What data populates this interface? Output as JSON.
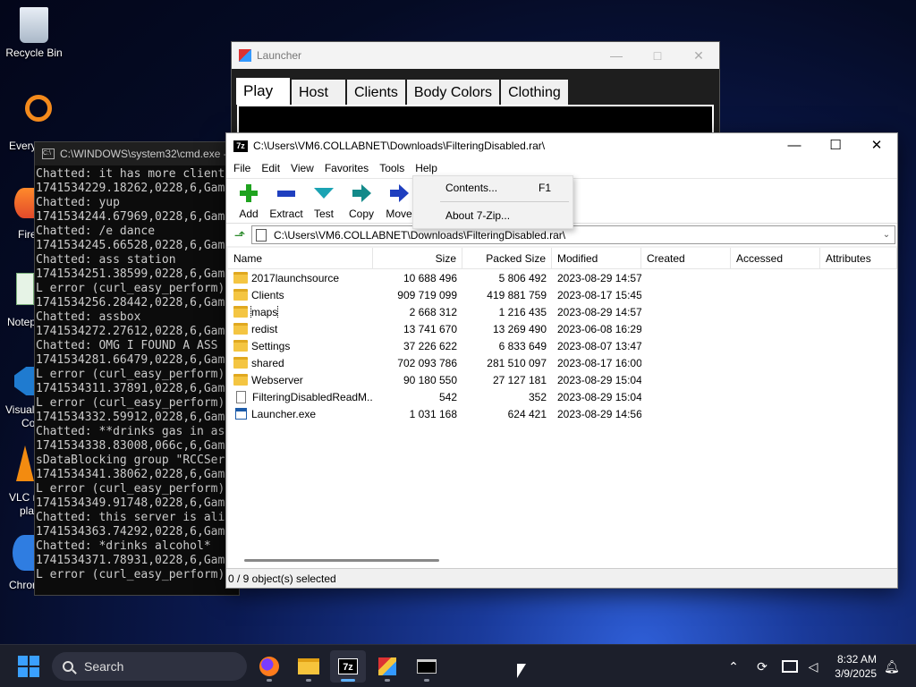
{
  "desktop": {
    "recycle_bin": "Recycle Bin",
    "partial_labels": [
      "Every",
      "Fire",
      "Notep",
      "Visual",
      "Co",
      "VLC r",
      "pla",
      "Chrom"
    ]
  },
  "launcher": {
    "title": "Launcher",
    "tabs": [
      "Play",
      "Host",
      "Clients",
      "Body Colors",
      "Clothing"
    ],
    "active_tab": "Play"
  },
  "cmd": {
    "title": "C:\\WINDOWS\\system32\\cmd.exe -",
    "lines": [
      "Chatted: it has more client",
      "1741534229.18262,0228,6,Gam",
      "Chatted: yup",
      "1741534244.67969,0228,6,Gam",
      "Chatted: /e dance",
      "1741534245.66528,0228,6,Gam",
      "Chatted: ass station",
      "1741534251.38599,0228,6,Gam",
      "L error (curl_easy_perform)",
      "1741534256.28442,0228,6,Gam",
      "Chatted: assbox",
      "1741534272.27612,0228,6,Gam",
      "Chatted: OMG I FOUND A ASS",
      "1741534281.66479,0228,6,Gam",
      "L error (curl_easy_perform)",
      "1741534311.37891,0228,6,Gam",
      "L error (curl_easy_perform)",
      "1741534332.59912,0228,6,Gam",
      "Chatted: **drinks gas in as",
      "1741534338.83008,066c,6,Gam",
      "sDataBlocking group \"RCCSer",
      "1741534341.38062,0228,6,Gam",
      "L error (curl_easy_perform)",
      "1741534349.91748,0228,6,Gam",
      "Chatted: this server is ali",
      "1741534363.74292,0228,6,Gam",
      "Chatted: *drinks alcohol*",
      "1741534371.78931,0228,6,Gam",
      "L error (curl_easy_perform)"
    ]
  },
  "zip": {
    "title": "C:\\Users\\VM6.COLLABNET\\Downloads\\FilteringDisabled.rar\\",
    "app_icon": "7z",
    "menu": [
      "File",
      "Edit",
      "View",
      "Favorites",
      "Tools",
      "Help"
    ],
    "tools": [
      {
        "label": "Add",
        "icon": "plus-icon",
        "color": "#1fa31f"
      },
      {
        "label": "Extract",
        "icon": "minus-icon",
        "color": "#1f3fbf"
      },
      {
        "label": "Test",
        "icon": "check-icon",
        "color": "#1ba3b3"
      },
      {
        "label": "Copy",
        "icon": "arrow-right-icon",
        "color": "#138a8a"
      },
      {
        "label": "Move",
        "icon": "arrow-right-icon",
        "color": "#1f3fbf"
      }
    ],
    "address": "C:\\Users\\VM6.COLLABNET\\Downloads\\FilteringDisabled.rar\\",
    "columns": {
      "name": "Name",
      "size": "Size",
      "packed": "Packed Size",
      "modified": "Modified",
      "created": "Created",
      "accessed": "Accessed",
      "attributes": "Attributes"
    },
    "rows": [
      {
        "name": "2017launchsource",
        "type": "folder",
        "size": "10 688 496",
        "packed": "5 806 492",
        "modified": "2023-08-29 14:57"
      },
      {
        "name": "Clients",
        "type": "folder",
        "size": "909 719 099",
        "packed": "419 881 759",
        "modified": "2023-08-17 15:45"
      },
      {
        "name": "maps",
        "type": "folder",
        "size": "2 668 312",
        "packed": "1 216 435",
        "modified": "2023-08-29 14:57",
        "focused": true
      },
      {
        "name": "redist",
        "type": "folder",
        "size": "13 741 670",
        "packed": "13 269 490",
        "modified": "2023-06-08 16:29"
      },
      {
        "name": "Settings",
        "type": "folder",
        "size": "37 226 622",
        "packed": "6 833 649",
        "modified": "2023-08-07 13:47"
      },
      {
        "name": "shared",
        "type": "folder",
        "size": "702 093 786",
        "packed": "281 510 097",
        "modified": "2023-08-17 16:00"
      },
      {
        "name": "Webserver",
        "type": "folder",
        "size": "90 180 550",
        "packed": "27 127 181",
        "modified": "2023-08-29 15:04"
      },
      {
        "name": "FilteringDisabledReadM...",
        "type": "file",
        "size": "542",
        "packed": "352",
        "modified": "2023-08-29 15:04"
      },
      {
        "name": "Launcher.exe",
        "type": "exe",
        "size": "1 031 168",
        "packed": "624 421",
        "modified": "2023-08-29 14:56"
      }
    ],
    "status": "0 / 9 object(s) selected"
  },
  "help_menu": {
    "items": [
      {
        "label": "Contents...",
        "shortcut": "F1"
      },
      {
        "label": "About 7-Zip...",
        "shortcut": ""
      }
    ]
  },
  "taskbar": {
    "search_placeholder": "Search",
    "apps": [
      "firefox-icon",
      "file-explorer-icon",
      "7zip-icon",
      "launcher-app-icon",
      "terminal-icon"
    ],
    "time": "8:32 AM",
    "date": "3/9/2025"
  }
}
